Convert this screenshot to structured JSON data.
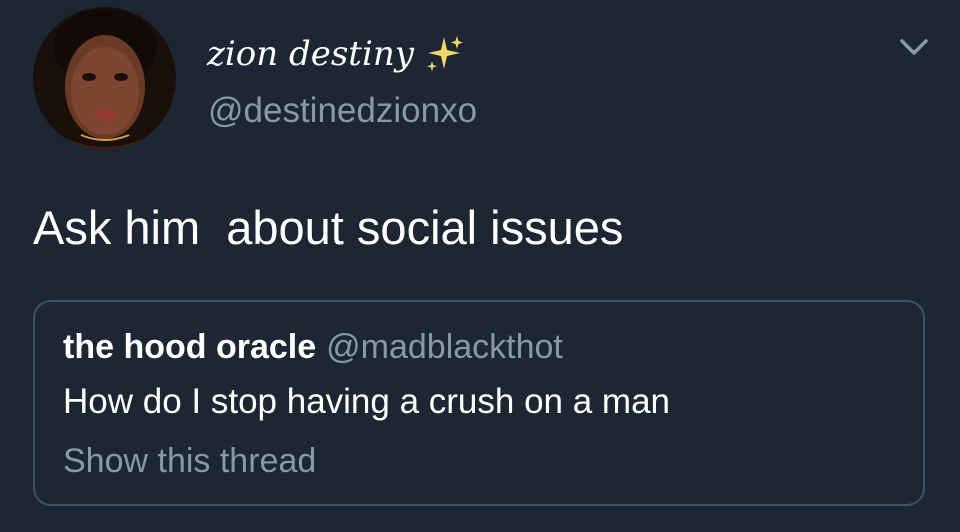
{
  "tweet": {
    "author": {
      "display_name": "zion destiny",
      "handle": "@destinedzionxo",
      "name_emoji_icon": "sparkles-icon",
      "avatar": "profile-photo"
    },
    "menu_icon": "chevron-down-icon",
    "text": "Ask him  about social issues",
    "quoted_tweet": {
      "display_name": "the hood oracle",
      "handle": "@madblackthot",
      "text": "How do I stop having a crush on a man",
      "show_thread_label": "Show this thread"
    }
  },
  "colors": {
    "background": "#1c2733",
    "primary_text": "#ffffff",
    "secondary_text": "#8899a6",
    "border": "#3d5466",
    "sparkle": "#f5d66b"
  }
}
